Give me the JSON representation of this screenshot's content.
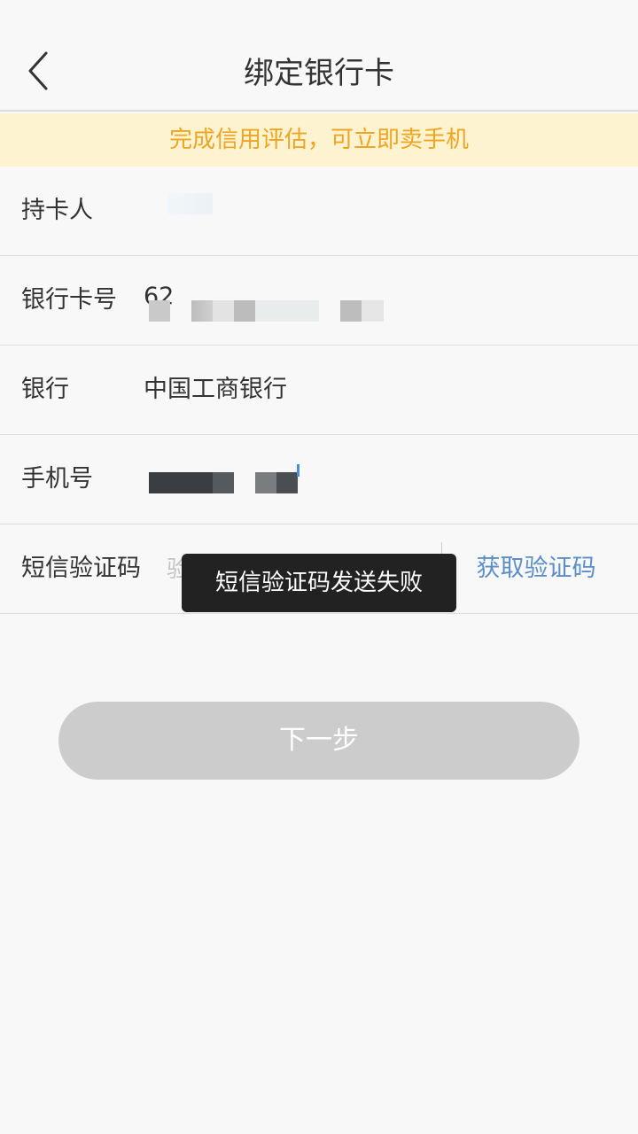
{
  "header": {
    "title": "绑定银行卡",
    "back_icon": "chevron-left-icon"
  },
  "banner": {
    "text": "完成信用评估，可立即卖手机",
    "color": "#f0a520",
    "background": "#fdf3d0"
  },
  "form": {
    "holder_label": "持卡人",
    "card_no_label": "银行卡号",
    "card_no_prefix": "62",
    "bank_label": "银行",
    "bank_value": "中国工商银行",
    "phone_label": "手机号",
    "sms_label": "短信验证码",
    "sms_placeholder": "验证码",
    "get_code_label": "获取验证码",
    "get_code_color": "#5b8ec7"
  },
  "toast": {
    "text": "短信验证码发送失败"
  },
  "actions": {
    "next_label": "下一步"
  }
}
